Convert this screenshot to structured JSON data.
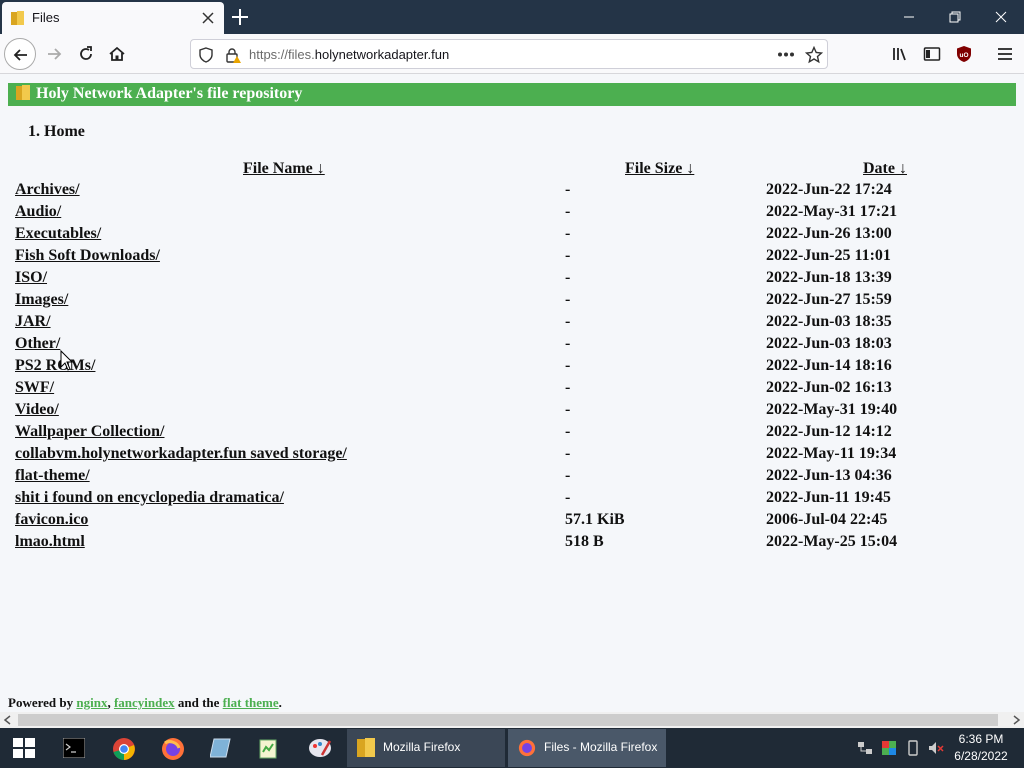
{
  "browser": {
    "tab_title": "Files",
    "url_prefix": "https://files.",
    "url_domain": "holynetworkadapter.fun"
  },
  "page": {
    "heading": "Holy Network Adapter's file repository",
    "breadcrumb": "1. Home",
    "columns": {
      "name": "File Name  ↓ ",
      "size": "File Size  ↓ ",
      "date": "Date  ↓ "
    },
    "rows": [
      {
        "name": "Archives/",
        "size": "-",
        "date": "2022-Jun-22 17:24"
      },
      {
        "name": "Audio/",
        "size": "-",
        "date": "2022-May-31 17:21"
      },
      {
        "name": "Executables/",
        "size": "-",
        "date": "2022-Jun-26 13:00"
      },
      {
        "name": "Fish Soft Downloads/",
        "size": "-",
        "date": "2022-Jun-25 11:01"
      },
      {
        "name": "ISO/",
        "size": "-",
        "date": "2022-Jun-18 13:39"
      },
      {
        "name": "Images/",
        "size": "-",
        "date": "2022-Jun-27 15:59"
      },
      {
        "name": "JAR/",
        "size": "-",
        "date": "2022-Jun-03 18:35"
      },
      {
        "name": "Other/",
        "size": "-",
        "date": "2022-Jun-03 18:03"
      },
      {
        "name": "PS2 ROMs/",
        "size": "-",
        "date": "2022-Jun-14 18:16"
      },
      {
        "name": "SWF/",
        "size": "-",
        "date": "2022-Jun-02 16:13"
      },
      {
        "name": "Video/",
        "size": "-",
        "date": "2022-May-31 19:40"
      },
      {
        "name": "Wallpaper Collection/",
        "size": "-",
        "date": "2022-Jun-12 14:12"
      },
      {
        "name": "collabvm.holynetworkadapter.fun saved storage/",
        "size": "-",
        "date": "2022-May-11 19:34"
      },
      {
        "name": "flat-theme/",
        "size": "-",
        "date": "2022-Jun-13 04:36"
      },
      {
        "name": "shit i found on encyclopedia dramatica/",
        "size": "-",
        "date": "2022-Jun-11 19:45"
      },
      {
        "name": "favicon.ico",
        "size": "57.1 KiB",
        "date": "2006-Jul-04 22:45"
      },
      {
        "name": "lmao.html",
        "size": "518 B",
        "date": "2022-May-25 15:04"
      }
    ],
    "footer": {
      "prefix": "Powered by ",
      "link1": "nginx",
      "sep1": ", ",
      "link2": "fancyindex",
      "sep2": " and the ",
      "link3": "flat theme",
      "suffix": "."
    }
  },
  "taskbar": {
    "windows": [
      {
        "label": "Mozilla Firefox"
      },
      {
        "label": "Files - Mozilla Firefox"
      }
    ],
    "time": "6:36 PM",
    "date": "6/28/2022"
  },
  "colors": {
    "banner": "#4caf50",
    "tabstrip": "#243447",
    "taskbar": "#1f2a36",
    "ublock": "#800000"
  }
}
